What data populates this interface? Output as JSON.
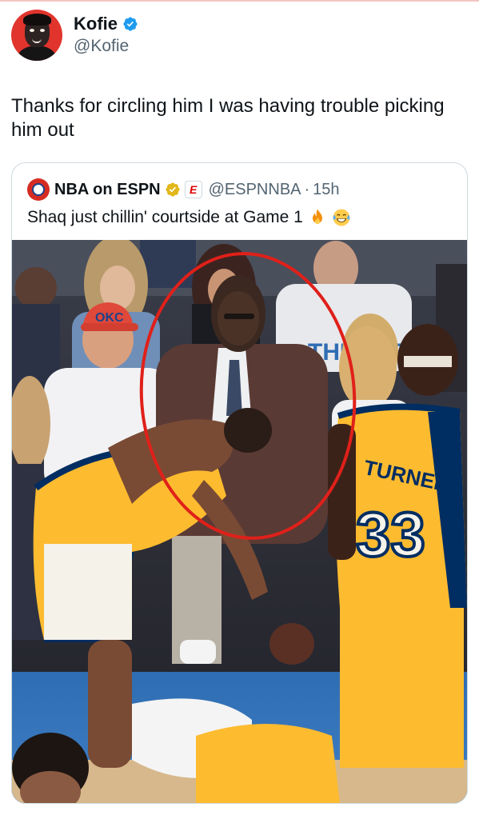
{
  "author": {
    "display_name": "Kofie",
    "handle": "@Kofie",
    "verified": true,
    "avatar_icon": "cartoon-avatar-icon",
    "verified_icon": "verified-badge-icon"
  },
  "tweet": {
    "text": "Thanks for circling him I was having trouble picking him out"
  },
  "quote": {
    "display_name": "NBA on ESPN",
    "handle": "@ESPNNBA",
    "separator": "·",
    "time": "15h",
    "affiliate_letter": "E",
    "avatar_icon": "nba-espn-logo-icon",
    "badge_icon": "gold-verified-badge-icon",
    "text": "Shaq just chillin' courtside at Game 1",
    "emojis": [
      "fire-emoji",
      "laughing-emoji"
    ]
  },
  "photo": {
    "jersey_name": "TURNER",
    "jersey_number": "33",
    "hat_text": "OKC",
    "shirt_text": "THUNDER",
    "highlight_color": "#e0201a"
  },
  "colors": {
    "verified_blue": "#1d9bf0",
    "gold_badge": "#e2b719",
    "pacers_yellow": "#fdbb30",
    "pacers_navy": "#002d62"
  }
}
